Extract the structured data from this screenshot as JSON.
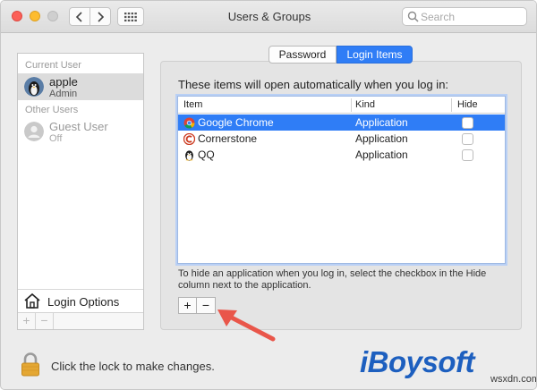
{
  "window": {
    "title": "Users & Groups",
    "search_placeholder": "Search"
  },
  "sidebar": {
    "current_user_label": "Current User",
    "other_users_label": "Other Users",
    "users": [
      {
        "name": "apple",
        "role": "Admin"
      },
      {
        "name": "Guest User",
        "role": "Off"
      }
    ],
    "login_options_label": "Login Options",
    "add_symbol": "+",
    "remove_symbol": "−"
  },
  "tabs": [
    {
      "label": "Password"
    },
    {
      "label": "Login Items"
    }
  ],
  "login_items": {
    "intro": "These items will open automatically when you log in:",
    "columns": {
      "item": "Item",
      "kind": "Kind",
      "hide": "Hide"
    },
    "rows": [
      {
        "name": "Google Chrome",
        "kind": "Application",
        "hidden": false,
        "icon": "chrome-icon"
      },
      {
        "name": "Cornerstone",
        "kind": "Application",
        "hidden": false,
        "icon": "cornerstone-icon"
      },
      {
        "name": "QQ",
        "kind": "Application",
        "hidden": false,
        "icon": "qq-penguin-icon"
      }
    ],
    "hint": "To hide an application when you log in, select the checkbox in the Hide column next to the application.",
    "add_symbol": "+",
    "remove_symbol": "−"
  },
  "lock": {
    "text": "Click the lock to make changes."
  },
  "watermark": {
    "brand": "iBoysoft",
    "site": "wsxdn.com"
  },
  "colors": {
    "accent": "#2f7df6",
    "arrow": "#e9564a",
    "brand": "#1d5fbf"
  }
}
